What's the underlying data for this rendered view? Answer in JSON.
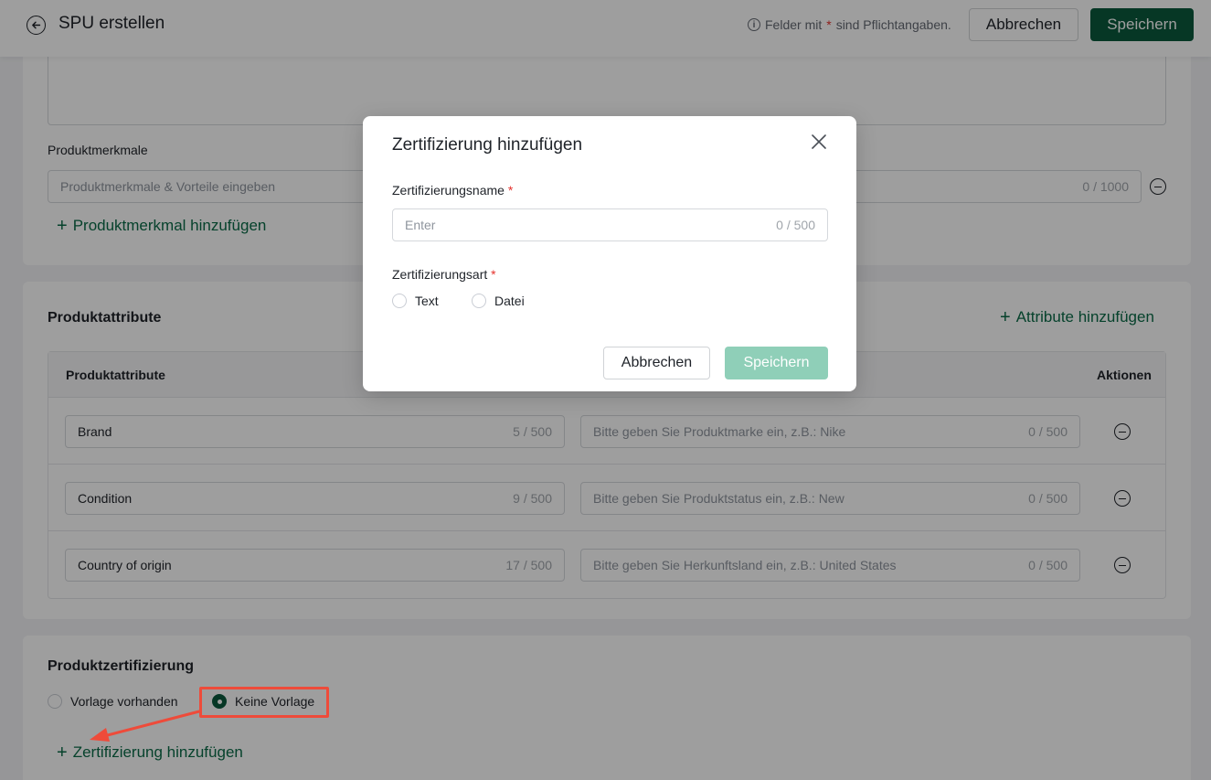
{
  "header": {
    "title": "SPU erstellen",
    "required_note_prefix": "Felder mit",
    "required_star": "*",
    "required_note_suffix": "sind Pflichtangaben.",
    "cancel_label": "Abbrechen",
    "save_label": "Speichern"
  },
  "features": {
    "label": "Produktmerkmale",
    "placeholder": "Produktmerkmale & Vorteile eingeben",
    "counter": "0 / 1000",
    "add_label": "Produktmerkmal hinzufügen"
  },
  "attributes": {
    "title": "Produktattribute",
    "add_label": "Attribute hinzufügen",
    "col_attribute": "Produktattribute",
    "col_actions": "Aktionen",
    "rows": [
      {
        "name": "Brand",
        "name_counter": "5 / 500",
        "value_placeholder": "Bitte geben Sie Produktmarke ein, z.B.: Nike",
        "value_counter": "0 / 500"
      },
      {
        "name": "Condition",
        "name_counter": "9 / 500",
        "value_placeholder": "Bitte geben Sie Produktstatus ein, z.B.: New",
        "value_counter": "0 / 500"
      },
      {
        "name": "Country of origin",
        "name_counter": "17 / 500",
        "value_placeholder": "Bitte geben Sie Herkunftsland ein, z.B.: United States",
        "value_counter": "0 / 500"
      }
    ]
  },
  "certification": {
    "title": "Produktzertifizierung",
    "option_template": "Vorlage vorhanden",
    "option_none": "Keine Vorlage",
    "selected": "Keine Vorlage",
    "add_label": "Zertifizierung hinzufügen"
  },
  "modal": {
    "title": "Zertifizierung hinzufügen",
    "name_label": "Zertifizierungsname",
    "name_placeholder": "Enter",
    "name_counter": "0 / 500",
    "type_label": "Zertifizierungsart",
    "type_options": [
      "Text",
      "Datei"
    ],
    "cancel_label": "Abbrechen",
    "save_label": "Speichern"
  },
  "colors": {
    "primary": "#0a5a3d",
    "primary_disabled": "#8fcfb8",
    "link": "#0a6b47",
    "required": "#e5322d",
    "annotation": "#ee4b3a"
  }
}
